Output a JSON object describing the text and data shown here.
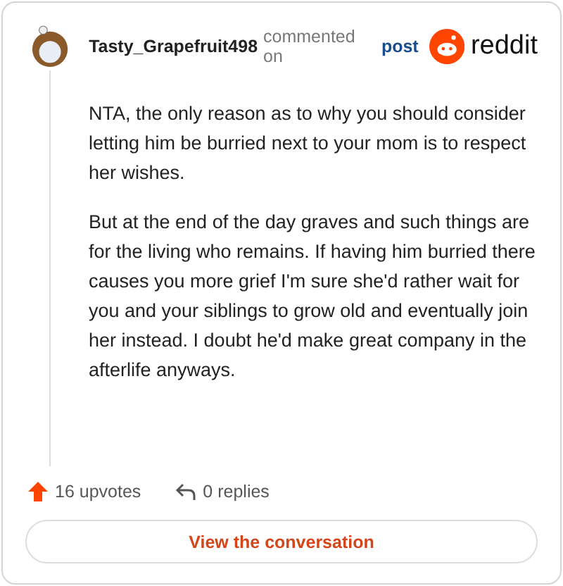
{
  "comment": {
    "author": "Tasty_Grapefruit498",
    "action": "commented on",
    "link": "post",
    "brand": "reddit",
    "paragraphs": [
      "NTA, the only reason as to why you should consider letting him be burried next to your mom is to respect her wishes.",
      "But at the end of the day graves and such things are for the living who remains. If having him burried there causes you more grief I'm sure she'd rather wait for you and your siblings to grow old and eventually join her instead. I doubt he'd make great company in the afterlife anyways."
    ]
  },
  "footer": {
    "upvotes": "16 upvotes",
    "replies": "0 replies"
  },
  "button": "View the conversation"
}
